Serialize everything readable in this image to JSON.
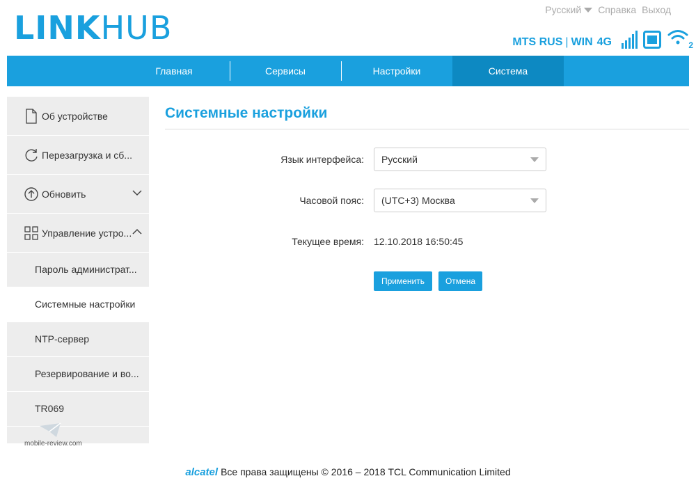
{
  "header": {
    "logo_bold": "LINK",
    "logo_light": "HUB",
    "language": "Русский",
    "help": "Справка",
    "logout": "Выход"
  },
  "status": {
    "operator": "MTS RUS",
    "separator": "|",
    "win": "WIN",
    "network": "4G",
    "wifi_clients": "2"
  },
  "nav": {
    "tabs": [
      {
        "label": "Главная"
      },
      {
        "label": "Сервисы"
      },
      {
        "label": "Настройки"
      },
      {
        "label": "Система"
      }
    ]
  },
  "sidebar": {
    "items": [
      {
        "label": "Об устройстве",
        "icon": "document-icon"
      },
      {
        "label": "Перезагрузка и сб...",
        "icon": "refresh-icon"
      },
      {
        "label": "Обновить",
        "icon": "upload-icon"
      },
      {
        "label": "Управление устро...",
        "icon": "grid-icon"
      }
    ],
    "subitems": [
      {
        "label": "Пароль администрат..."
      },
      {
        "label": "Системные настройки"
      },
      {
        "label": "NTP-сервер"
      },
      {
        "label": "Резервирование и во..."
      },
      {
        "label": "TR069"
      }
    ]
  },
  "main": {
    "title": "Системные настройки",
    "language_label": "Язык интерфейса:",
    "language_value": "Русский",
    "timezone_label": "Часовой пояс:",
    "timezone_value": "(UTC+3) Москва",
    "time_label": "Текущее время:",
    "time_value": "12.10.2018 16:50:45",
    "apply": "Применить",
    "cancel": "Отмена"
  },
  "watermark": "mobile-review.com",
  "footer": {
    "brand": "alcatel",
    "text": "Все права защищены © 2016 – 2018 TCL Communication Limited"
  },
  "colors": {
    "accent": "#1aa0de",
    "nav_active": "#0d89c2",
    "sidebar_bg": "#ededed"
  }
}
